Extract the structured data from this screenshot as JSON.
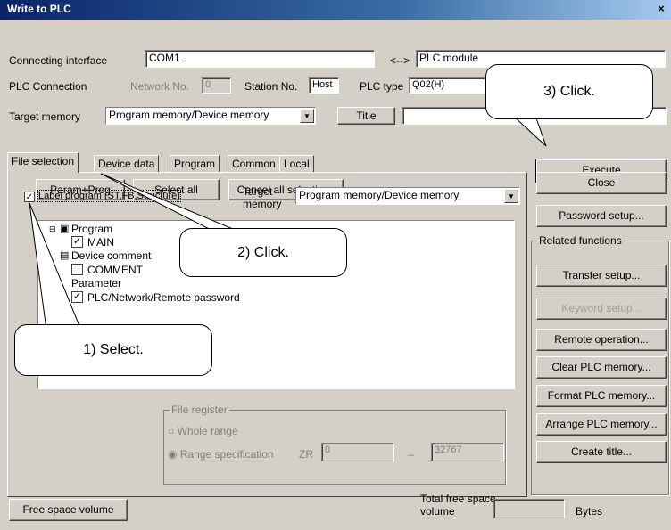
{
  "window": {
    "title": "Write to PLC",
    "close": "×"
  },
  "conn": {
    "interface_label": "Connecting interface",
    "interface_value": "COM1",
    "arrow": "<-->",
    "module_value": "PLC module",
    "plc_conn_label": "PLC Connection",
    "network_label": "Network No.",
    "network_value": "0",
    "station_label": "Station No.",
    "station_value": "Host",
    "plc_type_label": "PLC type",
    "plc_type_value": "Q02(H)"
  },
  "target": {
    "label": "Target memory",
    "value": "Program memory/Device memory",
    "title_button": "Title"
  },
  "tabs": [
    "File selection",
    "Device data",
    "Program",
    "Common",
    "Local"
  ],
  "file_selection": {
    "param_prog": "Param+Prog",
    "select_all": "Select all",
    "cancel_all": "Cancel all selections",
    "label_program": "Label program (ST,FB,Structure)",
    "label_program_checked": true,
    "target_memory_label": "Target memory",
    "target_memory_value": "Program memory/Device memory",
    "tree": [
      {
        "label": "Program"
      },
      {
        "label": "MAIN",
        "checked": true
      },
      {
        "label": "Device comment"
      },
      {
        "label": "COMMENT",
        "checked": false
      },
      {
        "label": "Parameter"
      },
      {
        "label": "PLC/Network/Remote password",
        "checked": true
      }
    ],
    "file_register": {
      "title": "File register",
      "whole_range": "Whole range",
      "range_spec": "Range specification",
      "zr": "ZR",
      "from": "0",
      "dash": "–",
      "to": "32767"
    }
  },
  "right": {
    "execute": "Execute",
    "close": "Close",
    "password_setup": "Password setup...",
    "related_title": "Related functions",
    "related": [
      "Transfer setup...",
      "Keyword setup...",
      "Remote operation...",
      "Clear PLC memory...",
      "Format PLC memory...",
      "Arrange PLC memory...",
      "Create title..."
    ]
  },
  "bottom": {
    "free_space": "Free space volume",
    "total_label_1": "Total free space",
    "total_label_2": "volume",
    "bytes": "Bytes"
  },
  "callouts": {
    "c1": "1) Select.",
    "c2": "2) Click.",
    "c3": "3) Click."
  }
}
